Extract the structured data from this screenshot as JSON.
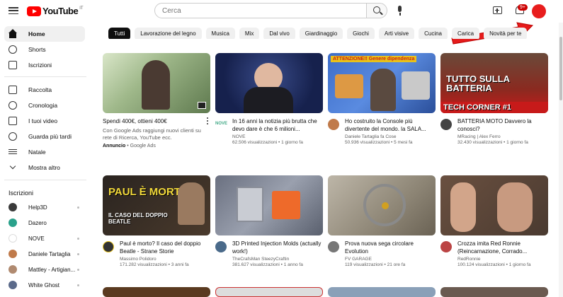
{
  "app": {
    "logo_text": "YouTube",
    "logo_country": "IT"
  },
  "header": {
    "search_placeholder": "Cerca",
    "notifications_badge": "9+"
  },
  "sidebar": {
    "main": [
      {
        "label": "Home",
        "icon": "home-icon",
        "active": true
      },
      {
        "label": "Shorts",
        "icon": "shorts-icon"
      },
      {
        "label": "Iscrizioni",
        "icon": "subscriptions-icon"
      }
    ],
    "you": [
      {
        "label": "Raccolta",
        "icon": "library-icon"
      },
      {
        "label": "Cronologia",
        "icon": "history-icon"
      },
      {
        "label": "I tuoi video",
        "icon": "your-videos-icon"
      },
      {
        "label": "Guarda più tardi",
        "icon": "watch-later-icon"
      },
      {
        "label": "Natale",
        "icon": "playlist-icon"
      },
      {
        "label": "Mostra altro",
        "icon": "chevron-down-icon"
      }
    ],
    "subs_title": "Iscrizioni",
    "subs": [
      {
        "label": "Help3D",
        "color": "#3a3a3a"
      },
      {
        "label": "Dazero",
        "color": "#2aa18b"
      },
      {
        "label": "NOVE",
        "color": "#ffffff"
      },
      {
        "label": "Daniele Tartaglia",
        "color": "#c07a4a"
      },
      {
        "label": "Mattley - Artigian...",
        "color": "#b08a70"
      },
      {
        "label": "White Ghost",
        "color": "#5b6a8a"
      }
    ]
  },
  "chips": [
    "Tutti",
    "Lavorazione del legno",
    "Musica",
    "Mix",
    "Dal vivo",
    "Giardinaggio",
    "Giochi",
    "Arti visive",
    "Cucina",
    "Carica",
    "Novità per te"
  ],
  "videos_row1": [
    {
      "title": "Spendi 400€, ottieni 400€",
      "desc": "Con Google Ads raggiungi nuovi clienti su rete di Ricerca, YouTube ecc.",
      "ad_label": "Annuncio",
      "ad_source": "Google Ads"
    },
    {
      "title": "In 16 anni la notizia più brutta che devo dare è che 6 milioni...",
      "channel": "NOVE",
      "stats": "62.506 visualizzazioni • 1 giorno fa",
      "badge": "NOVE"
    },
    {
      "title": "Ho costruito la Console più divertente del mondo. la SALA...",
      "channel": "Daniele Tartaglia fa Cose",
      "stats": "50.936 visualizzazioni • 5 mesi fa",
      "overlay": "ATTENZIONE!! Genere dipendenza"
    },
    {
      "title": "BATTERIA MOTO Davvero la conosci?",
      "channel": "MRacing | Alex Ferro",
      "stats": "32.430 visualizzazioni • 1 giorno fa",
      "overlay": "TUTTO SULLA BATTERIA",
      "overlay2": "TECH CORNER #1"
    }
  ],
  "videos_row2": [
    {
      "title": "Paul è morto? Il caso del doppio Beatle - Strane Storie",
      "channel": "Massimo Polidoro",
      "stats": "171.282 visualizzazioni • 3 anni fa",
      "overlay": "PAUL È MORTO?",
      "overlay2": "IL CASO DEL DOPPIO BEATLE"
    },
    {
      "title": "3D Printed Injection Molds (actually work!)",
      "channel": "TheCrafsMan SteezyCraftin",
      "stats": "381.627 visualizzazioni • 1 anno fa"
    },
    {
      "title": "Prova nuova sega circolare Evolution",
      "channel": "FV GARAGE",
      "stats": "119 visualizzazioni • 21 ore fa"
    },
    {
      "title": "Crozza imita Red Ronnie (Reincarnazione, Corrado...",
      "channel": "RedRonnie",
      "stats": "100.124 visualizzazioni • 1 giorno fa"
    }
  ]
}
